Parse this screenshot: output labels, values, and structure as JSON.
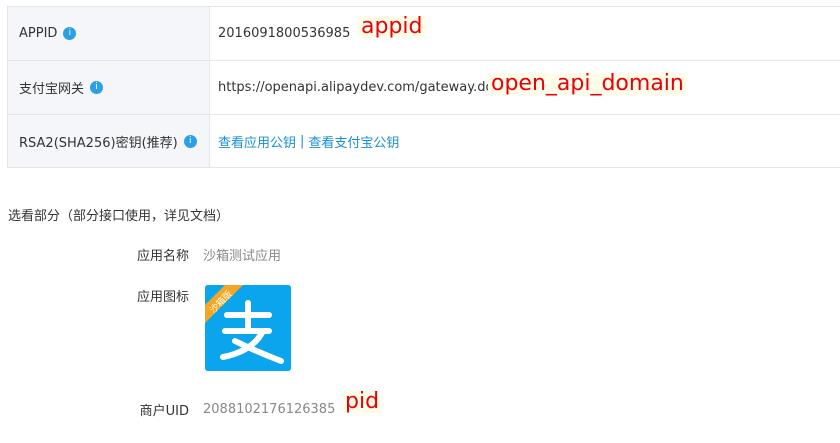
{
  "info": {
    "appid_label": "APPID",
    "appid_value": "2016091800536985",
    "gateway_label": "支付宝网关",
    "gateway_value": "https://openapi.alipaydev.com/gateway.do",
    "rsa_label": "RSA2(SHA256)密钥(推荐)",
    "link_app_key": "查看应用公钥",
    "link_separator": "|",
    "link_alipay_key": "查看支付宝公钥",
    "info_badge": "i"
  },
  "annotations": {
    "appid": "appid",
    "gateway": "open_api_domain",
    "pid": "pid"
  },
  "optional": {
    "title": "选看部分（部分接口使用，详见文档）",
    "app_name_label": "应用名称",
    "app_name_value": "沙箱测试应用",
    "app_icon_label": "应用图标",
    "icon_ribbon": "沙箱版",
    "merchant_uid_label": "商户UID",
    "merchant_uid_value": "2088102176126385"
  },
  "colors": {
    "accent": "#1890d5",
    "annotation": "#e8000b",
    "icon_bg": "#0aa5ec",
    "ribbon": "#f5a623"
  }
}
